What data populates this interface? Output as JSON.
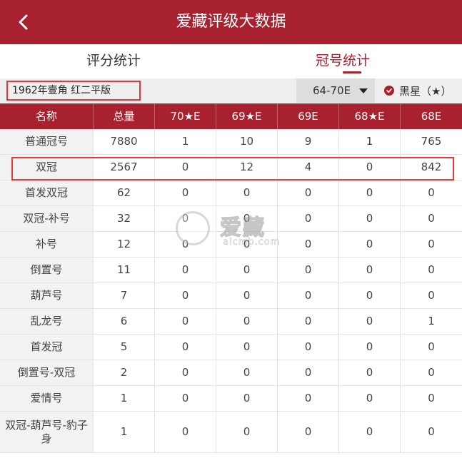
{
  "header": {
    "title": "爱藏评级大数据"
  },
  "tabs": [
    {
      "label": "评分统计"
    },
    {
      "label": "冠号统计"
    }
  ],
  "filter": {
    "coin": "1962年壹角 红二平版",
    "range": "64-70E",
    "black_star_label": "黑星（★）"
  },
  "table": {
    "headers": [
      "名称",
      "总量",
      "70★E",
      "69★E",
      "69E",
      "68★E",
      "68E"
    ],
    "rows": [
      [
        "普通冠号",
        "7880",
        "1",
        "10",
        "9",
        "1",
        "765"
      ],
      [
        "双冠",
        "2567",
        "0",
        "12",
        "4",
        "0",
        "842"
      ],
      [
        "首发双冠",
        "62",
        "0",
        "0",
        "0",
        "0",
        "0"
      ],
      [
        "双冠-补号",
        "32",
        "0",
        "0",
        "0",
        "0",
        "0"
      ],
      [
        "补号",
        "12",
        "0",
        "0",
        "0",
        "0",
        "0"
      ],
      [
        "倒置号",
        "11",
        "0",
        "0",
        "0",
        "0",
        "0"
      ],
      [
        "葫芦号",
        "7",
        "0",
        "0",
        "0",
        "0",
        "0"
      ],
      [
        "乱龙号",
        "6",
        "0",
        "0",
        "0",
        "0",
        "1"
      ],
      [
        "首发冠",
        "5",
        "0",
        "0",
        "0",
        "0",
        "0"
      ],
      [
        "倒置号-双冠",
        "2",
        "0",
        "0",
        "0",
        "0",
        "0"
      ],
      [
        "爱情号",
        "1",
        "0",
        "0",
        "0",
        "0",
        "0"
      ],
      [
        "双冠-葫芦号-豹子身",
        "1",
        "0",
        "0",
        "0",
        "0",
        "0"
      ]
    ]
  },
  "watermark": {
    "text": "爱藏",
    "url": "aicmb.com"
  },
  "colors": {
    "brand": "#a8212e",
    "highlight": "#e53935"
  }
}
